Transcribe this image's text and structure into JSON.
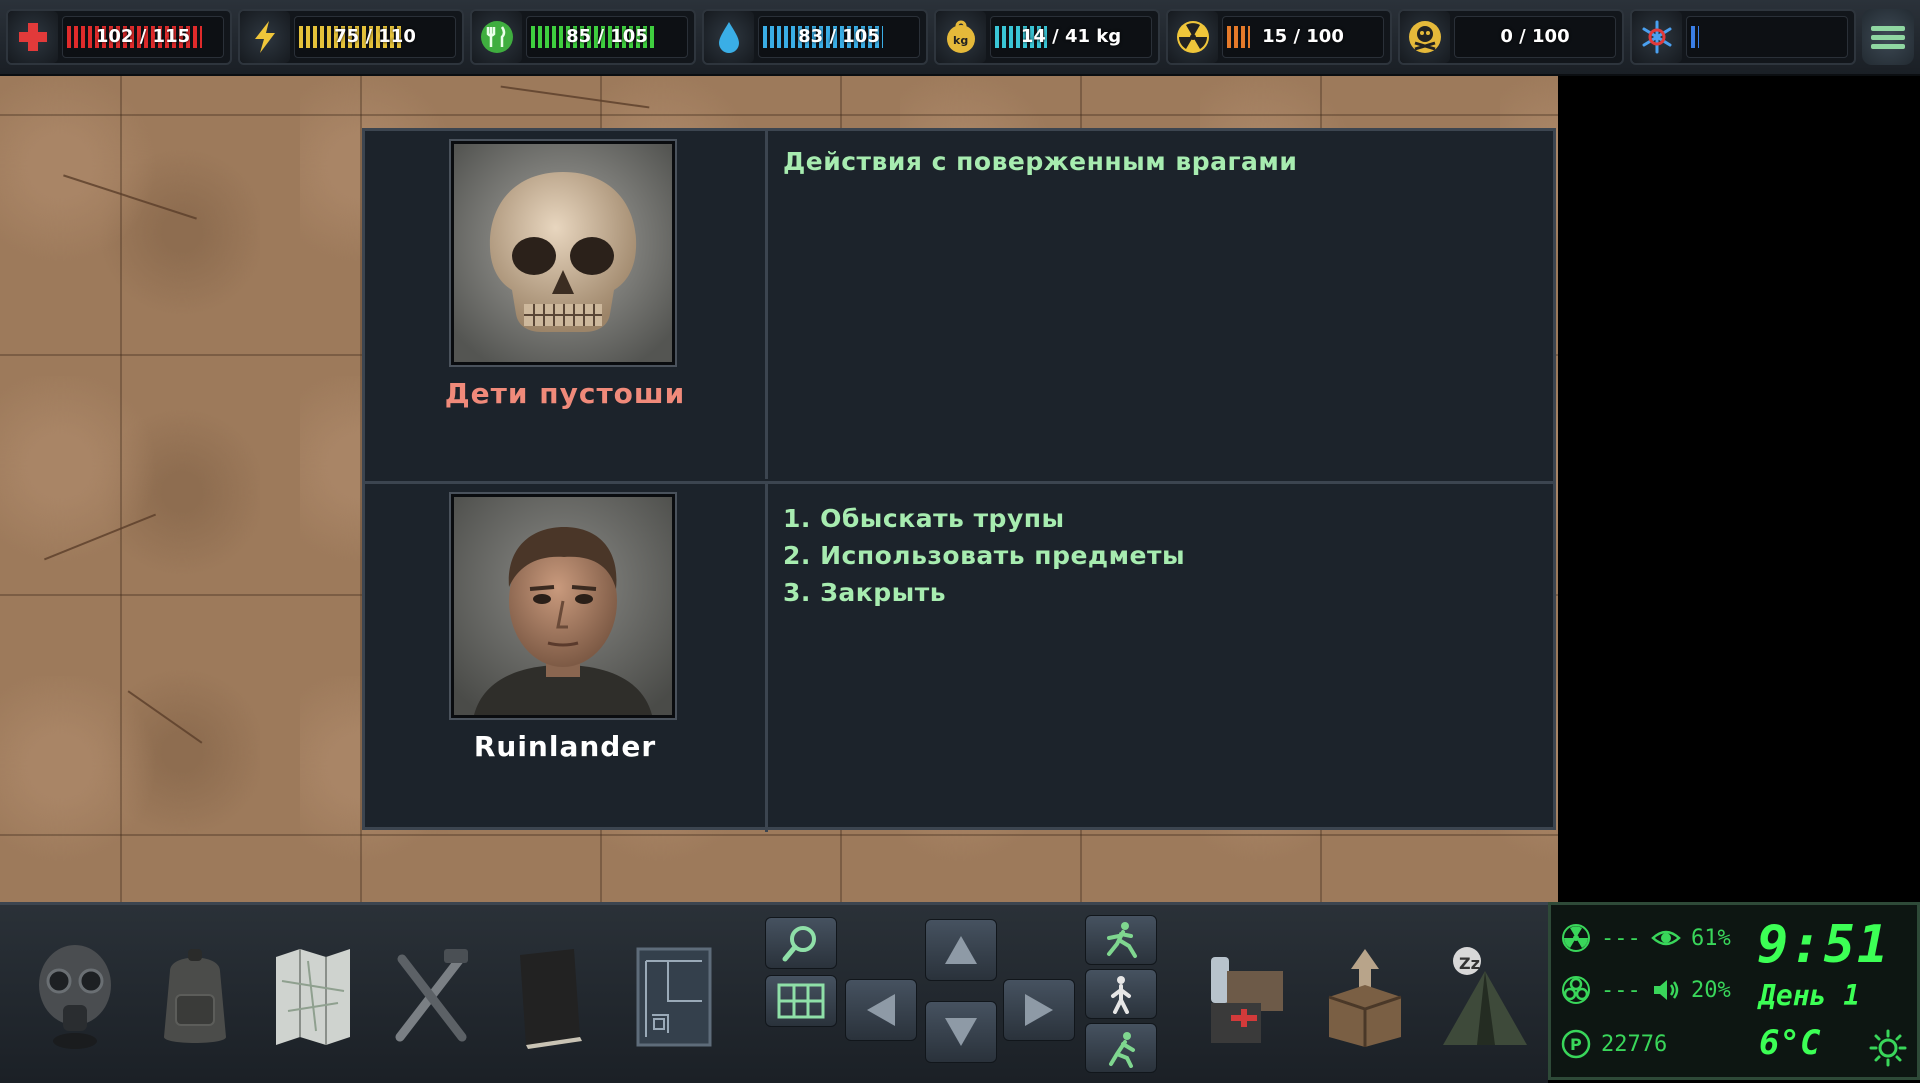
{
  "topbar": {
    "stats": [
      {
        "id": "health",
        "icon": "health-cross-icon",
        "value": "102 / 115",
        "fraction": 0.887,
        "color": "#e02b2b"
      },
      {
        "id": "energy",
        "icon": "lightning-icon",
        "value": "75 / 110",
        "fraction": 0.682,
        "color": "#e5c23a"
      },
      {
        "id": "food",
        "icon": "fork-knife-icon",
        "value": "85 / 105",
        "fraction": 0.81,
        "color": "#3fcf3f"
      },
      {
        "id": "water",
        "icon": "water-drop-icon",
        "value": "83 / 105",
        "fraction": 0.79,
        "color": "#3aaee6"
      },
      {
        "id": "weight",
        "icon": "kg-weight-icon",
        "value": "14 / 41 kg",
        "fraction": 0.341,
        "color": "#3ac6d6"
      },
      {
        "id": "radiation",
        "icon": "radiation-icon",
        "value": "15 / 100",
        "fraction": 0.15,
        "color": "#e57a2a"
      },
      {
        "id": "toxin",
        "icon": "skull-crossbones-icon",
        "value": "0 / 100",
        "fraction": 0.0,
        "color": "#9acb3a"
      },
      {
        "id": "temperature",
        "icon": "snowflake-icon",
        "value": "",
        "fraction": 0.05,
        "color": "#3a7ee6"
      }
    ]
  },
  "dialog": {
    "enemy": {
      "name": "Дети пустоши",
      "name_color": "#f08a7a",
      "portrait": "skull-portrait"
    },
    "title": "Действия с поверженным врагами",
    "player": {
      "name": "Ruinlander",
      "portrait": "man-portrait"
    },
    "options": [
      "1. Обыскать трупы",
      "2. Использовать предметы",
      "3. Закрыть"
    ]
  },
  "toolbar": {
    "tools": [
      "gas-mask-icon",
      "backpack-icon",
      "map-icon",
      "tools-icon",
      "journal-icon",
      "blueprint-icon"
    ],
    "right_tools": [
      "supplies-icon",
      "build-box-icon",
      "sleep-tent-icon"
    ]
  },
  "info": {
    "radiation_label": "---",
    "bio_label": "---",
    "visibility": "61%",
    "noise": "20%",
    "money": "22776",
    "time": "9:51",
    "day": "День 1",
    "temperature": "6°C",
    "weather_icon": "sun-icon"
  }
}
